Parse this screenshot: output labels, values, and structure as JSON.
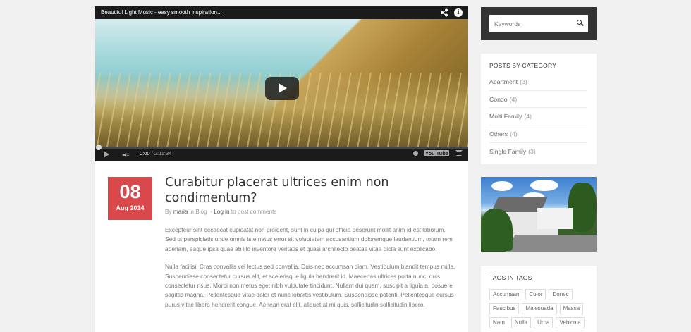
{
  "video": {
    "title": "Beautiful Light Music - easy smooth inspiration...",
    "current_time": "0:00",
    "duration": "/ 2:11:34",
    "youtube_label_a": "You",
    "youtube_label_b": "Tube",
    "progress": 0
  },
  "post": {
    "day": "08",
    "month_year": "Aug 2014",
    "title": "Curabitur placerat ultrices enim non condimentum?",
    "meta_by": "By",
    "meta_author": "maria",
    "meta_in": "in Blog",
    "meta_sep": "-",
    "meta_login": "Log in",
    "meta_to_comment": "to post comments",
    "paragraphs": [
      "Excepteur sint occaecat cupidatat non proident, sunt in culpa qui officia deserunt mollit anim id est laborum. Sed ut perspiciatis unde omnis iste natus error sit voluptatem accusantium doloremque laudantium, totam rem aperiam, eaque ipsa quae ab illo inventore veritatis et quasi architecto beatae vitae dicta sunt explicabo.",
      "Nulla facilisi. Cras convallis vel lectus sed convallis. Duis nec accumsan diam. Vestibulum blandit tempus nulla. Suspendisse consectetur cursus elit, et scelerisque ligula hendrerit id. Maecenas ultrices porta nunc, quis consectetur risus. Morbi non metus eget nibh vulputate tincidunt. Nullam dui quam, suscipit a ligula a, posuere sagittis magna. Pellentesque vitae dolor et nunc lobortis vestibulum. Suspendisse potenti. Pellentesque cursus purus vitae libero hendrerit congue. Aenean erat elit, aliquet at mi quis, sollicitudin sollicitudin libero."
    ]
  },
  "search": {
    "placeholder": "Keywords"
  },
  "categories": {
    "title": "POSTS BY CATEGORY",
    "items": [
      {
        "label": "Apartment",
        "count": "(3)"
      },
      {
        "label": "Condo",
        "count": "(4)"
      },
      {
        "label": "Multi Family",
        "count": "(4)"
      },
      {
        "label": "Others",
        "count": "(4)"
      },
      {
        "label": "Single Family",
        "count": "(3)"
      }
    ]
  },
  "tags": {
    "title": "TAGS IN TAGS",
    "items": [
      "Accumsan",
      "Color",
      "Donec",
      "Faucibus",
      "Malesuada",
      "Massa",
      "Nam",
      "Nulla",
      "Urna",
      "Vehicula"
    ]
  },
  "colors": {
    "date_badge": "#d9484a",
    "search_bg": "#333333"
  }
}
